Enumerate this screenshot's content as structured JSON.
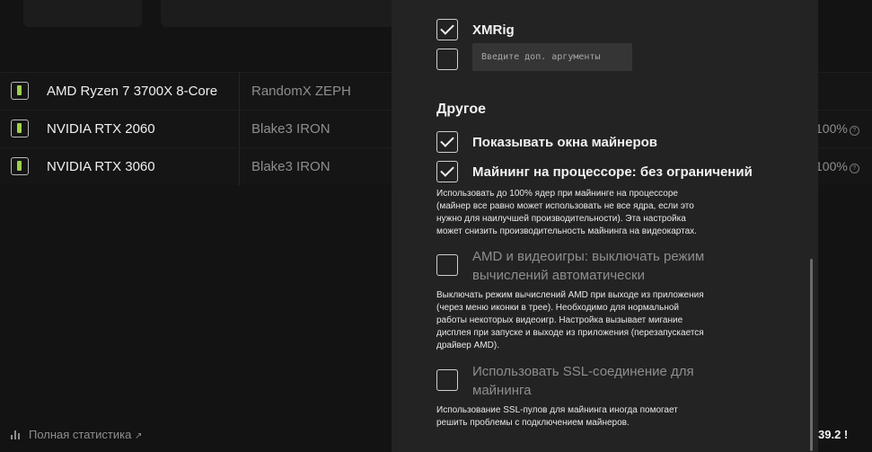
{
  "devices": [
    {
      "name": "AMD Ryzen 7 3700X 8-Core",
      "algo": "RandomX ZEPH",
      "pct": ""
    },
    {
      "name": "NVIDIA RTX 2060",
      "algo": "Blake3 IRON",
      "pct": "100%"
    },
    {
      "name": "NVIDIA RTX 3060",
      "algo": "Blake3 IRON",
      "pct": "100%"
    }
  ],
  "footer": {
    "full_stats": "Полная статистика",
    "external_arrow": "↗",
    "right_value": "39.2 !"
  },
  "settings": {
    "xmrig": {
      "label": "XMRig",
      "checked": true
    },
    "args": {
      "placeholder": "Введите доп. аргументы",
      "checked": false
    },
    "other_heading": "Другое",
    "show_windows": {
      "label": "Показывать окна майнеров",
      "checked": true
    },
    "cpu_unlimited": {
      "label": "Майнинг на процессоре: без ограничений",
      "checked": true,
      "desc": [
        "Использовать до 100% ядер при майнинге на процессоре",
        "(майнер все равно может использовать не все ядра, если это",
        "нужно для наилучшей производительности). Эта настройка",
        "может снизить производительность майнинга на видеокартах."
      ]
    },
    "amd_games": {
      "label": [
        "AMD и видеоигры: выключать режим",
        "вычислений автоматически"
      ],
      "checked": false,
      "desc": [
        "Выключать режим вычислений AMD при выходе из приложения",
        "(через меню иконки в трее). Необходимо для нормальной",
        "работы некоторых видеоигр. Настройка вызывает мигание",
        "дисплея при запуске и выходе из приложения (перезапускается",
        "драйвер AMD)."
      ]
    },
    "ssl": {
      "label": [
        "Использовать SSL-соединение для",
        "майнинга"
      ],
      "checked": false,
      "desc": [
        "Использование SSL-пулов для майнинга иногда помогает",
        "решить проблемы с подключением майнеров."
      ]
    }
  },
  "info_icon_glyph": "?"
}
